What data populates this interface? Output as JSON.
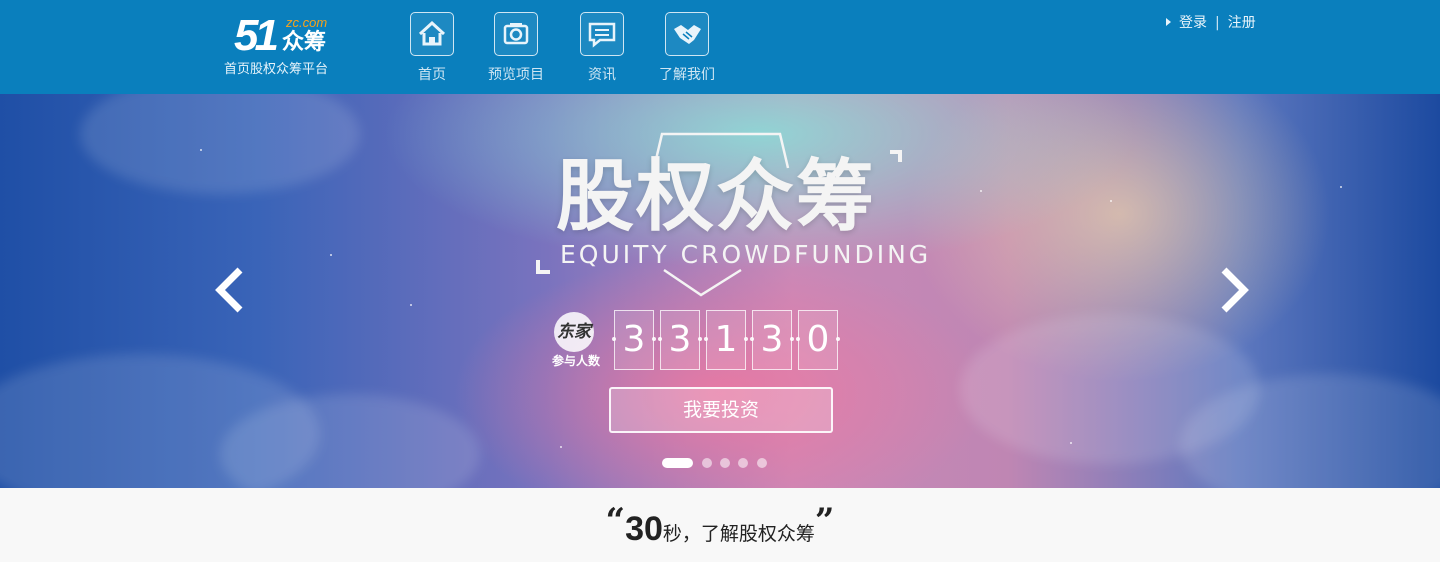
{
  "brand": {
    "mark": "51",
    "domain": "zc.com",
    "name": "众筹",
    "tagline": "首页股权众筹平台"
  },
  "nav": [
    {
      "label": "首页",
      "icon": "home-icon"
    },
    {
      "label": "预览项目",
      "icon": "camera-icon"
    },
    {
      "label": "资讯",
      "icon": "chat-icon"
    },
    {
      "label": "了解我们",
      "icon": "handshake-icon"
    }
  ],
  "auth": {
    "login": "登录",
    "separator": "|",
    "register": "注册"
  },
  "banner": {
    "title": "股权众筹",
    "subtitle": "EQUITY CROWDFUNDING",
    "badge_text": "东家",
    "counter_label": "参与人数",
    "digits": [
      "3",
      "3",
      "1",
      "3",
      "0"
    ],
    "cta": "我要投资",
    "slides_total": 5,
    "active_slide": 1
  },
  "slogan": {
    "open_quote": "“",
    "number": "30",
    "text": "秒，了解股权众筹",
    "close_quote": "”"
  },
  "colors": {
    "header": "#0a7fbd",
    "brand_accent": "#f7a21b"
  }
}
